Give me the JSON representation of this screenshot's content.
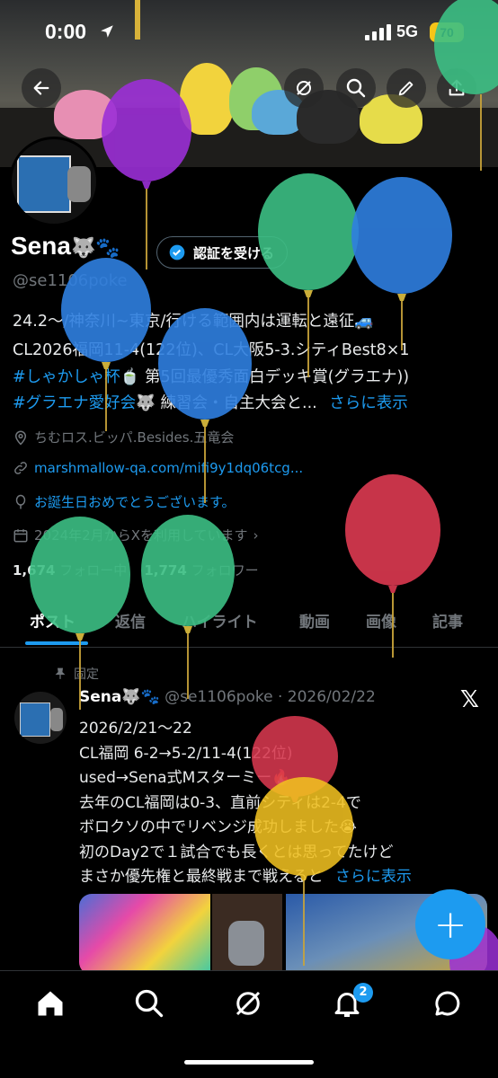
{
  "status": {
    "time": "0:00",
    "network": "5G",
    "battery": "70"
  },
  "profile": {
    "name": "Sena",
    "name_emoji": "🐺🐾",
    "verify_label": "認証を受ける",
    "handle": "@se1106poke",
    "bio_line1": "24.2～/神奈川~東京/行ける範囲内は運転と遠征🚙",
    "bio_line2": "CL2026福岡11-4(122位)、CL大阪5-3.シティBest8×1",
    "bio_line3a": "#しゃかしゃ杯🍵",
    "bio_line3b": " 第5回最優秀面白デッキ賞(グラエナ))",
    "bio_line4a": "#グラエナ愛好会🐺",
    "bio_line4b": " 練習会・自主大会と...",
    "bio_more": "さらに表示",
    "location": "ちむロス.ビッパ.Besides.五竜会",
    "website": "marshmallow-qa.com/mifi9y1dq06tcg...",
    "birthday": "お誕生日おめでとうございます。",
    "joined": "2024年2月からXを利用しています",
    "following_count": "1,674",
    "following_label": "フォロー中",
    "followers_count": "1,774",
    "followers_label": "フォロワー"
  },
  "tabs": [
    "ポスト",
    "返信",
    "ハイライト",
    "動画",
    "画像",
    "記事"
  ],
  "post": {
    "pinned_label": "固定",
    "author": "Sena🐺🐾",
    "handle_date": "@se1106poke · 2026/02/22",
    "lines": [
      "2026/2/21～22",
      "CL福岡 6-2→5-2/11-4(122位)",
      "used→Sena式Mスターミー🔥",
      "去年のCL福岡は0-3、直前シティは2-4で",
      "ボロクソの中でリベンジ成功しました😭",
      "初のDay2で１試合でも長くとは思ってたけど"
    ],
    "last_line": "まさか優先権と最終戦まで戦えると",
    "more": "さらに表示"
  },
  "fab_label": "+",
  "nav": {
    "notification_badge": "2"
  },
  "colors": {
    "accent": "#1d9bf0",
    "background": "#000000",
    "muted": "#71767b"
  },
  "icons": [
    "back-icon",
    "hide-icon",
    "search-icon",
    "edit-icon",
    "share-icon",
    "location-icon",
    "link-icon",
    "balloon-icon",
    "calendar-icon",
    "pin-icon",
    "x-logo-icon",
    "home-icon",
    "search-nav-icon",
    "grok-icon",
    "bell-icon",
    "messages-icon"
  ]
}
